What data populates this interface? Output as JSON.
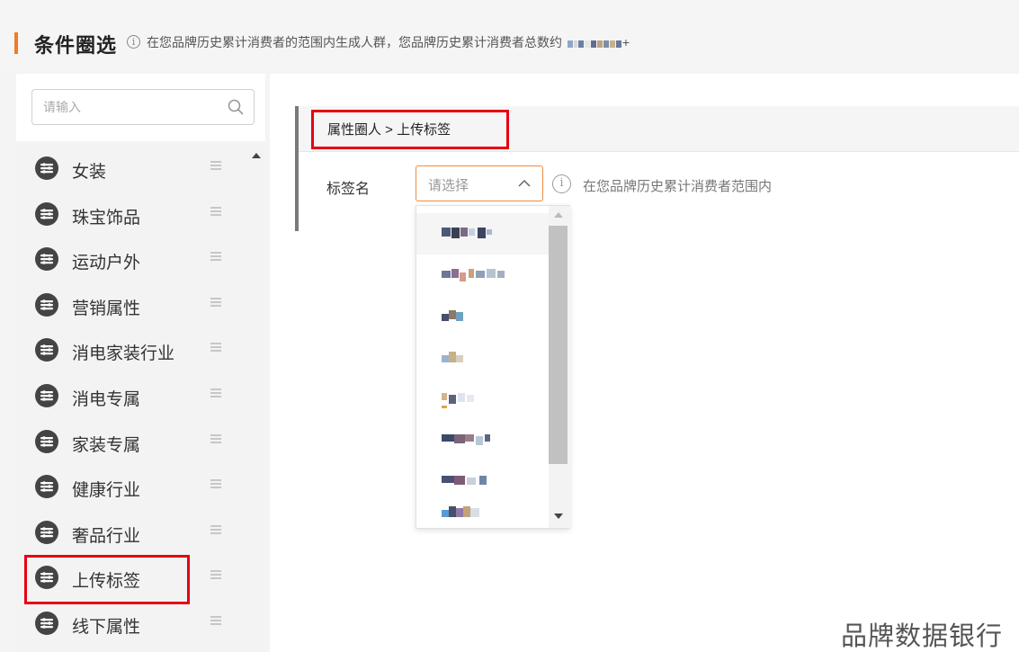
{
  "header": {
    "title": "条件圈选",
    "info_icon": "info-icon",
    "description": "在您品牌历史累计消费者的范围内生成人群，您品牌历史累计消费者总数约",
    "count_suffix": "+"
  },
  "sidebar": {
    "search_placeholder": "请输入",
    "items": [
      {
        "label": "女装"
      },
      {
        "label": "珠宝饰品"
      },
      {
        "label": "运动户外"
      },
      {
        "label": "营销属性"
      },
      {
        "label": "消电家装行业"
      },
      {
        "label": "消电专属"
      },
      {
        "label": "家装专属"
      },
      {
        "label": "健康行业"
      },
      {
        "label": "奢品行业"
      },
      {
        "label": "上传标签"
      },
      {
        "label": "线下属性"
      }
    ]
  },
  "main": {
    "breadcrumb": "属性圈人 > 上传标签",
    "field_label": "标签名",
    "select_placeholder": "请选择",
    "hint": "在您品牌历史累计消费者范围内"
  },
  "watermark": "品牌数据银行",
  "colors": {
    "accent": "#f07b28",
    "highlight": "#e60012",
    "select_border": "#f08a3c"
  }
}
